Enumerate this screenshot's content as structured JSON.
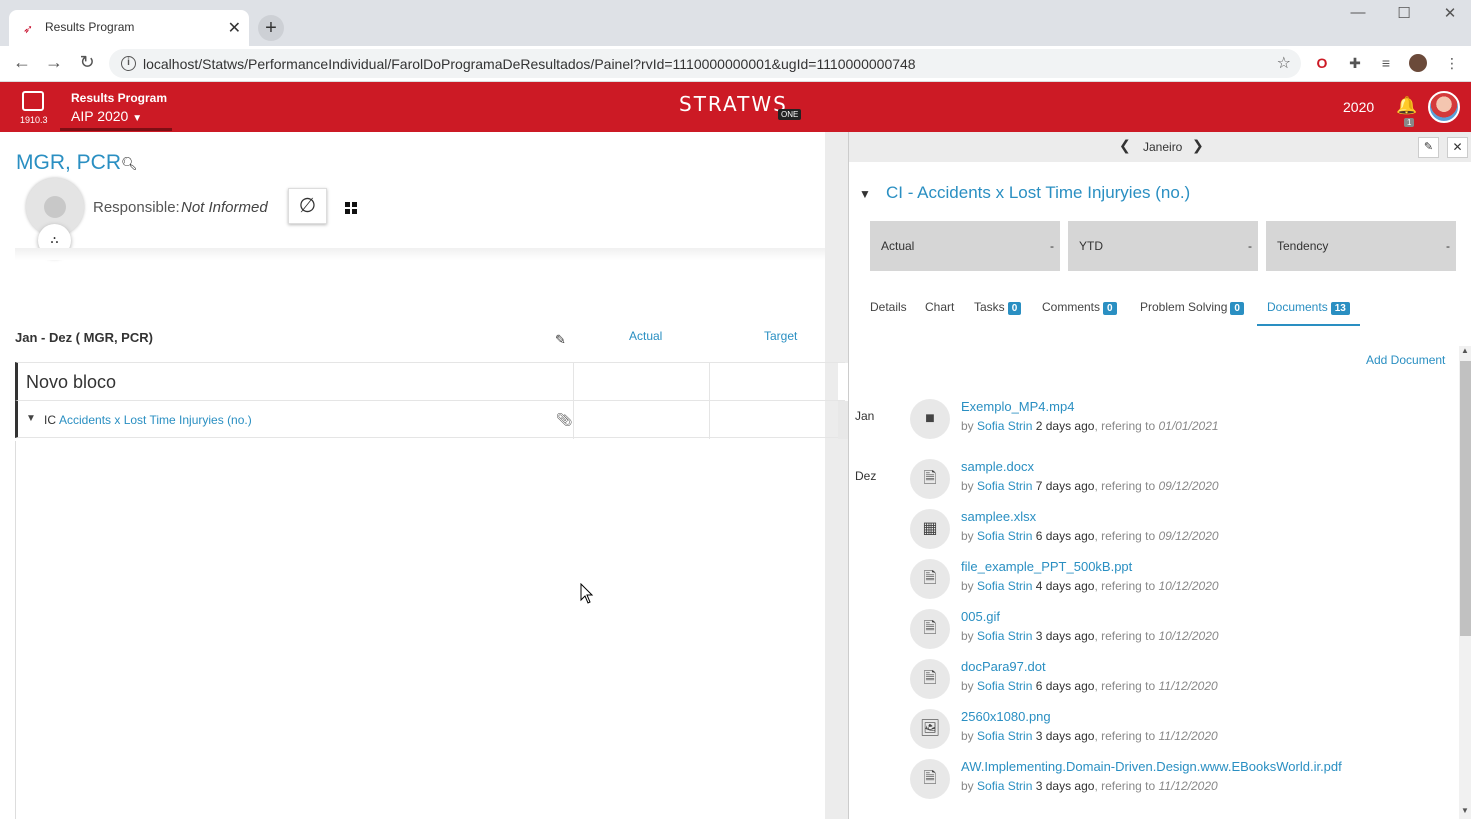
{
  "browser": {
    "tab_title": "Results Program",
    "url": "localhost/Statws/PerformanceIndividual/FarolDoProgramaDeResultados/Painel?rvId=1110000000001&ugId=1110000000748"
  },
  "header": {
    "version": "1910.3",
    "program_title": "Results Program",
    "program_sub": "AIP 2020",
    "brand": "STRATWS",
    "brand_tag": "ONE",
    "year": "2020",
    "notif_count": "1"
  },
  "left": {
    "title": "MGR, PCR",
    "responsible_label": "Responsible:",
    "responsible_value": "Not Informed",
    "null_symbol": "∅",
    "period": "Jan - Dez ( MGR, PCR)",
    "col_actual": "Actual",
    "col_target": "Target",
    "block_name": "Novo bloco",
    "indicator_code": "IC",
    "indicator_name": "Accidents x Lost Time Injuryies (no.)"
  },
  "right": {
    "month": "Janeiro",
    "ci_title": "CI - Accidents x Lost Time Injuryies (no.)",
    "kpis": [
      {
        "label": "Actual",
        "value": "-"
      },
      {
        "label": "YTD",
        "value": "-"
      },
      {
        "label": "Tendency",
        "value": "-"
      }
    ],
    "tabs": [
      {
        "label": "Details",
        "badge": ""
      },
      {
        "label": "Chart",
        "badge": ""
      },
      {
        "label": "Tasks",
        "badge": "0"
      },
      {
        "label": "Comments",
        "badge": "0"
      },
      {
        "label": "Problem Solving",
        "badge": "0"
      },
      {
        "label": "Documents",
        "badge": "13"
      }
    ],
    "add_document": "Add Document",
    "groups": [
      "Jan",
      "Dez"
    ],
    "by_label": "by",
    "ref_label": ", refering to",
    "documents": [
      {
        "name": "Exemplo_MP4.mp4",
        "author": "Sofia Strin",
        "ago": "2 days ago",
        "date": "01/01/2021",
        "icon": "video-icon"
      },
      {
        "name": "sample.docx",
        "author": "Sofia Strin",
        "ago": "7 days ago",
        "date": "09/12/2020",
        "icon": "document-icon"
      },
      {
        "name": "samplee.xlsx",
        "author": "Sofia Strin",
        "ago": "6 days ago",
        "date": "09/12/2020",
        "icon": "spreadsheet-icon"
      },
      {
        "name": "file_example_PPT_500kB.ppt",
        "author": "Sofia Strin",
        "ago": "4 days ago",
        "date": "10/12/2020",
        "icon": "document-icon"
      },
      {
        "name": "005.gif",
        "author": "Sofia Strin",
        "ago": "3 days ago",
        "date": "10/12/2020",
        "icon": "document-icon"
      },
      {
        "name": "docPara97.dot",
        "author": "Sofia Strin",
        "ago": "6 days ago",
        "date": "11/12/2020",
        "icon": "document-icon"
      },
      {
        "name": "2560x1080.png",
        "author": "Sofia Strin",
        "ago": "3 days ago",
        "date": "11/12/2020",
        "icon": "image-icon"
      },
      {
        "name": "AW.Implementing.Domain-Driven.Design.www.EBooksWorld.ir.pdf",
        "author": "Sofia Strin",
        "ago": "3 days ago",
        "date": "11/12/2020",
        "icon": "document-icon"
      }
    ]
  }
}
